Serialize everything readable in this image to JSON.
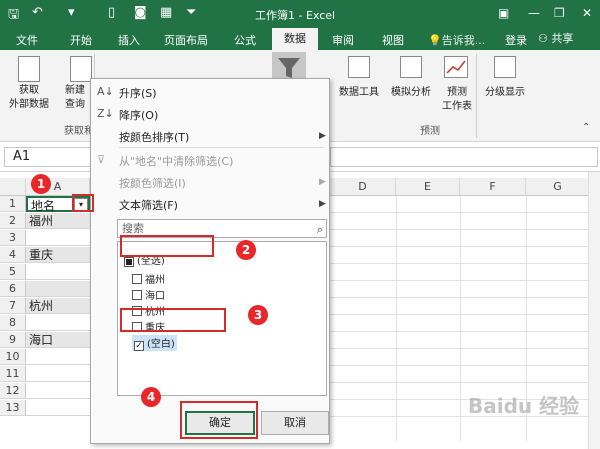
{
  "titlebar": {
    "title": "工作簿1 - Excel",
    "quick_access": [
      "save-icon",
      "undo-icon",
      "new-icon",
      "camera-icon",
      "macro-icon",
      "customize-icon"
    ],
    "window_controls": [
      "minimize-icon",
      "restore-icon",
      "close-icon"
    ]
  },
  "tabs": {
    "items": [
      "文件",
      "开始",
      "插入",
      "页面布局",
      "公式",
      "数据",
      "审阅",
      "视图"
    ],
    "active": "数据",
    "tellme": "告诉我...",
    "login": "登录",
    "share": "共享"
  },
  "ribbon": {
    "get_data": "获取",
    "get_data2": "外部数据",
    "new_query": "新建",
    "new_query2": "查询",
    "group_get": "获取和",
    "data_tools": "数据工具",
    "whatif": "模拟分析",
    "forecast": "预测",
    "forecast2": "工作表",
    "outline": "分级显示",
    "group_forecast": "预测"
  },
  "formula_bar": {
    "namebox": "A1"
  },
  "grid": {
    "columns": [
      "A",
      "D",
      "E",
      "F",
      "G"
    ],
    "rows": [
      "1",
      "2",
      "3",
      "4",
      "5",
      "6",
      "7",
      "8",
      "9",
      "10",
      "11",
      "12",
      "13"
    ],
    "colA": [
      "地名",
      "福州",
      "",
      "重庆",
      "",
      "",
      "杭州",
      "",
      "海口",
      "",
      "",
      "",
      ""
    ]
  },
  "menu": {
    "sort_asc": "升序(S)",
    "sort_desc": "降序(O)",
    "sort_color": "按颜色排序(T)",
    "clear_filter": "从\"地名\"中清除筛选(C)",
    "filter_color": "按颜色筛选(I)",
    "text_filter": "文本筛选(F)",
    "search_placeholder": "搜索",
    "items": [
      {
        "label": "(全选)",
        "state": "indeterminate"
      },
      {
        "label": "福州",
        "state": "unchecked"
      },
      {
        "label": "海口",
        "state": "unchecked"
      },
      {
        "label": "杭州",
        "state": "unchecked"
      },
      {
        "label": "重庆",
        "state": "unchecked"
      },
      {
        "label": "(空白)",
        "state": "checked"
      }
    ],
    "ok": "确定",
    "cancel": "取消"
  },
  "annotations": {
    "markers": [
      "1",
      "2",
      "3",
      "4"
    ],
    "accent": "#e8272a"
  },
  "watermark": "Baidu 经验",
  "colors": {
    "excel_green": "#217346"
  }
}
